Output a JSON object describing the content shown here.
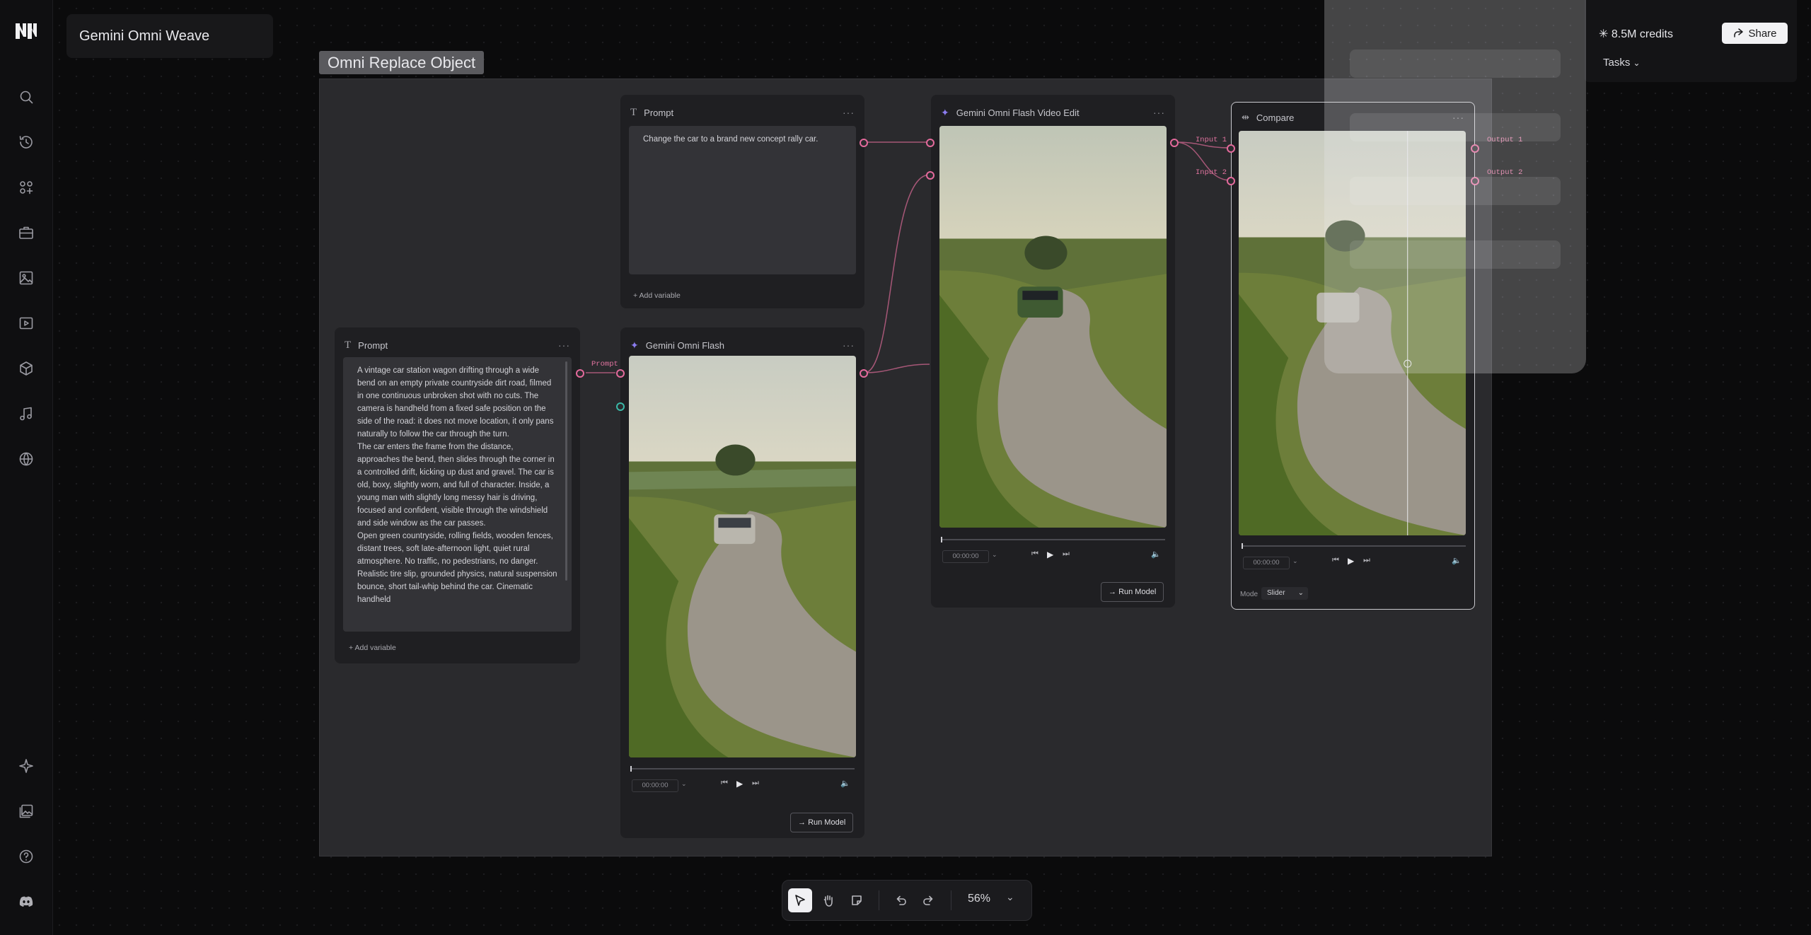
{
  "app": {
    "project_title": "Gemini Omni Weave",
    "group_title": "Omni Replace Object"
  },
  "sidebar": {
    "icons": [
      "logo-icon",
      "search-icon",
      "history-icon",
      "apps-icon",
      "toolbox-icon",
      "image-icon",
      "video-icon",
      "cube-icon",
      "music-icon",
      "globe-icon",
      "sparkle-icon",
      "gallery-icon",
      "help-icon",
      "discord-icon"
    ]
  },
  "topbar": {
    "credits": "8.5M credits",
    "share_label": "Share",
    "tasks_label": "Tasks"
  },
  "nodes": {
    "prompt_top": {
      "title": "Prompt",
      "text": "Change the car to a brand new concept rally car.",
      "add_variable": "Add variable"
    },
    "prompt_left": {
      "title": "Prompt",
      "text": "A vintage car station wagon drifting through a wide bend on an empty private countryside dirt road, filmed in one continuous unbroken shot with no cuts. The camera is handheld from a fixed safe position on the side of the road: it does not move location, it only pans naturally to follow the car through the turn.\nThe car enters the frame from the distance, approaches the bend, then slides through the corner in a controlled drift, kicking up dust and gravel. The car is old, boxy, slightly worn, and full of character. Inside, a young man with slightly long messy hair is driving, focused and confident, visible through the windshield and side window as the car passes.\nOpen green countryside, rolling fields, wooden fences, distant trees, soft late-afternoon light, quiet rural atmosphere. No traffic, no pedestrians, no danger. Realistic tire slip, grounded physics, natural suspension bounce, short tail-whip behind the car. Cinematic handheld",
      "add_variable": "Add variable",
      "port_label": "Prompt"
    },
    "flash": {
      "title": "Gemini Omni Flash",
      "time": "00:00:00",
      "run_label": "Run Model"
    },
    "video_edit": {
      "title": "Gemini Omni Flash Video Edit",
      "time": "00:00:00",
      "run_label": "Run Model"
    },
    "compare": {
      "title": "Compare",
      "time": "00:00:00",
      "input1": "Input 1",
      "input2": "Input 2",
      "output1": "Output 1",
      "output2": "Output 2",
      "mode_label": "Mode",
      "mode_value": "Slider"
    }
  },
  "toolbar": {
    "zoom": "56%"
  },
  "colors": {
    "accent": "#e46a9c",
    "teal": "#3ab8a7",
    "star": "#8b7cf0"
  }
}
